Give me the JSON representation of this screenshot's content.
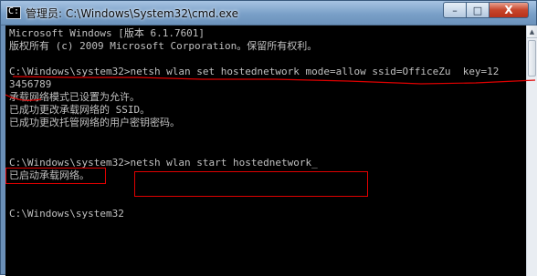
{
  "window": {
    "title": "管理员: C:\\Windows\\System32\\cmd.exe",
    "controls": {
      "minimize": "–",
      "maximize": "□",
      "close": "X"
    }
  },
  "console": {
    "lines": [
      "Microsoft Windows [版本 6.1.7601]",
      "版权所有 (c) 2009 Microsoft Corporation。保留所有权利。",
      "",
      "C:\\Windows\\system32>netsh wlan set hostednetwork mode=allow ssid=OfficeZu  key=12",
      "3456789",
      "承载网络模式已设置为允许。",
      "已成功更改承载网络的 SSID。",
      "已成功更改托管网络的用户密钥密码。",
      "",
      "",
      "C:\\Windows\\system32>netsh wlan start hostednetwork_",
      "已启动承载网络。",
      "",
      "",
      "C:\\Windows\\system32"
    ]
  },
  "annotation_color": "#e00000",
  "icons": {
    "app": "cmd-icon",
    "scroll_up": "scroll-up-arrow-icon"
  }
}
